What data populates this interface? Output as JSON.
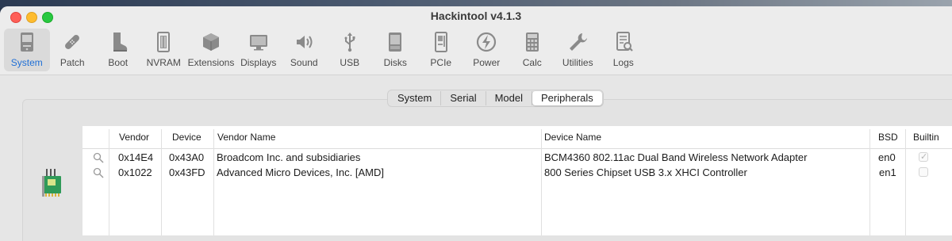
{
  "app": {
    "title": "Hackintool v4.1.3"
  },
  "toolbar": {
    "items": [
      {
        "label": "System",
        "icon": "system-icon",
        "active": true
      },
      {
        "label": "Patch",
        "icon": "patch-icon"
      },
      {
        "label": "Boot",
        "icon": "boot-icon"
      },
      {
        "label": "NVRAM",
        "icon": "nvram-icon"
      },
      {
        "label": "Extensions",
        "icon": "extensions-icon"
      },
      {
        "label": "Displays",
        "icon": "displays-icon"
      },
      {
        "label": "Sound",
        "icon": "sound-icon"
      },
      {
        "label": "USB",
        "icon": "usb-icon"
      },
      {
        "label": "Disks",
        "icon": "disks-icon"
      },
      {
        "label": "PCIe",
        "icon": "pcie-icon"
      },
      {
        "label": "Power",
        "icon": "power-icon"
      },
      {
        "label": "Calc",
        "icon": "calc-icon"
      },
      {
        "label": "Utilities",
        "icon": "utilities-icon"
      },
      {
        "label": "Logs",
        "icon": "logs-icon"
      }
    ],
    "accent_color": "#1f6fd6"
  },
  "tabs": {
    "items": [
      "System",
      "Serial",
      "Model",
      "Peripherals"
    ],
    "selected": "Peripherals"
  },
  "table": {
    "columns": [
      "Vendor",
      "Device",
      "Vendor Name",
      "Device Name",
      "BSD",
      "Builtin"
    ],
    "rows": [
      {
        "vendor": "0x14E4",
        "device": "0x43A0",
        "vendor_name": "Broadcom Inc. and subsidiaries",
        "device_name": "BCM4360 802.11ac Dual Band Wireless Network Adapter",
        "bsd": "en0",
        "builtin": true
      },
      {
        "vendor": "0x1022",
        "device": "0x43FD",
        "vendor_name": "Advanced Micro Devices, Inc. [AMD]",
        "device_name": "800 Series Chipset USB 3.x XHCI Controller",
        "bsd": "en1",
        "builtin": false
      }
    ]
  }
}
